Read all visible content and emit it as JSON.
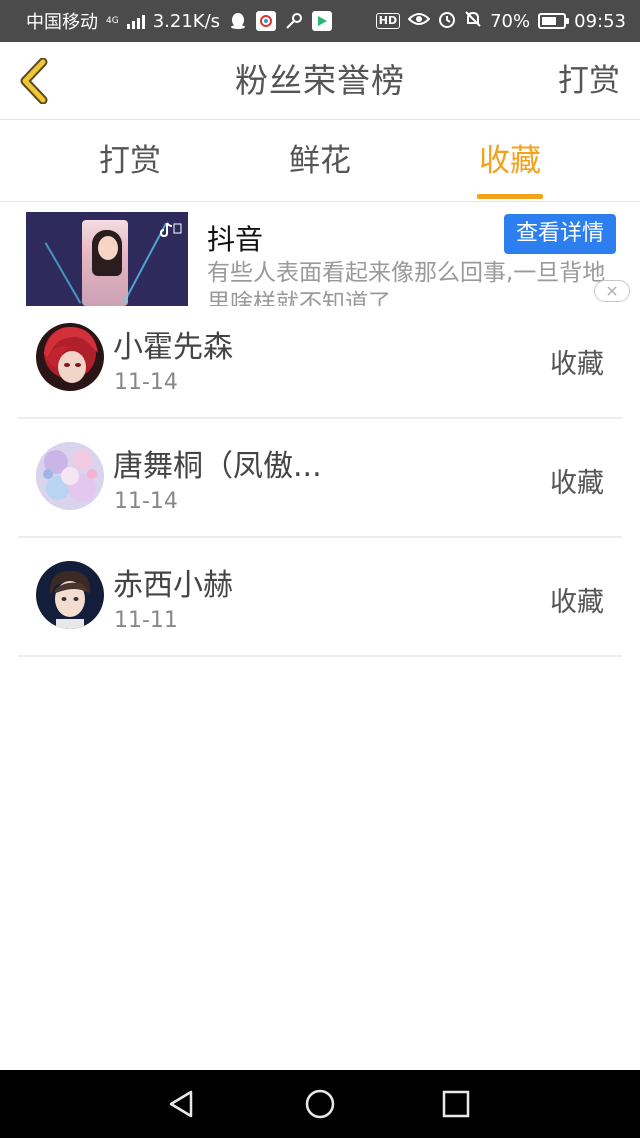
{
  "status_bar": {
    "carrier": "中国移动",
    "network": "4G",
    "speed": "3.21K/s",
    "hd": "HD",
    "battery": "70%",
    "battery_level": 0.7,
    "time": "09:53"
  },
  "header": {
    "title": "粉丝荣誉榜",
    "right_action": "打赏"
  },
  "tabs": [
    {
      "label": "打赏",
      "active": false
    },
    {
      "label": "鲜花",
      "active": false
    },
    {
      "label": "收藏",
      "active": true
    }
  ],
  "ad": {
    "title": "抖音",
    "description": "有些人表面看起来像那么回事,一旦背地里啥样就不知道了",
    "button_label": "查看详情"
  },
  "list": [
    {
      "name": "小霍先森",
      "date": "11-14",
      "action": "收藏"
    },
    {
      "name": "唐舞桐（凤傲...",
      "date": "11-14",
      "action": "收藏"
    },
    {
      "name": "赤西小赫",
      "date": "11-11",
      "action": "收藏"
    }
  ],
  "colors": {
    "accent": "#f3a21c",
    "ad_button": "#2d7ff0",
    "status_bar": "#4b4b4b",
    "nav_bar": "#000000"
  },
  "icons": {
    "back": "chevron-left-icon",
    "nav_back": "triangle-back-icon",
    "nav_home": "circle-home-icon",
    "nav_recent": "square-recents-icon"
  }
}
